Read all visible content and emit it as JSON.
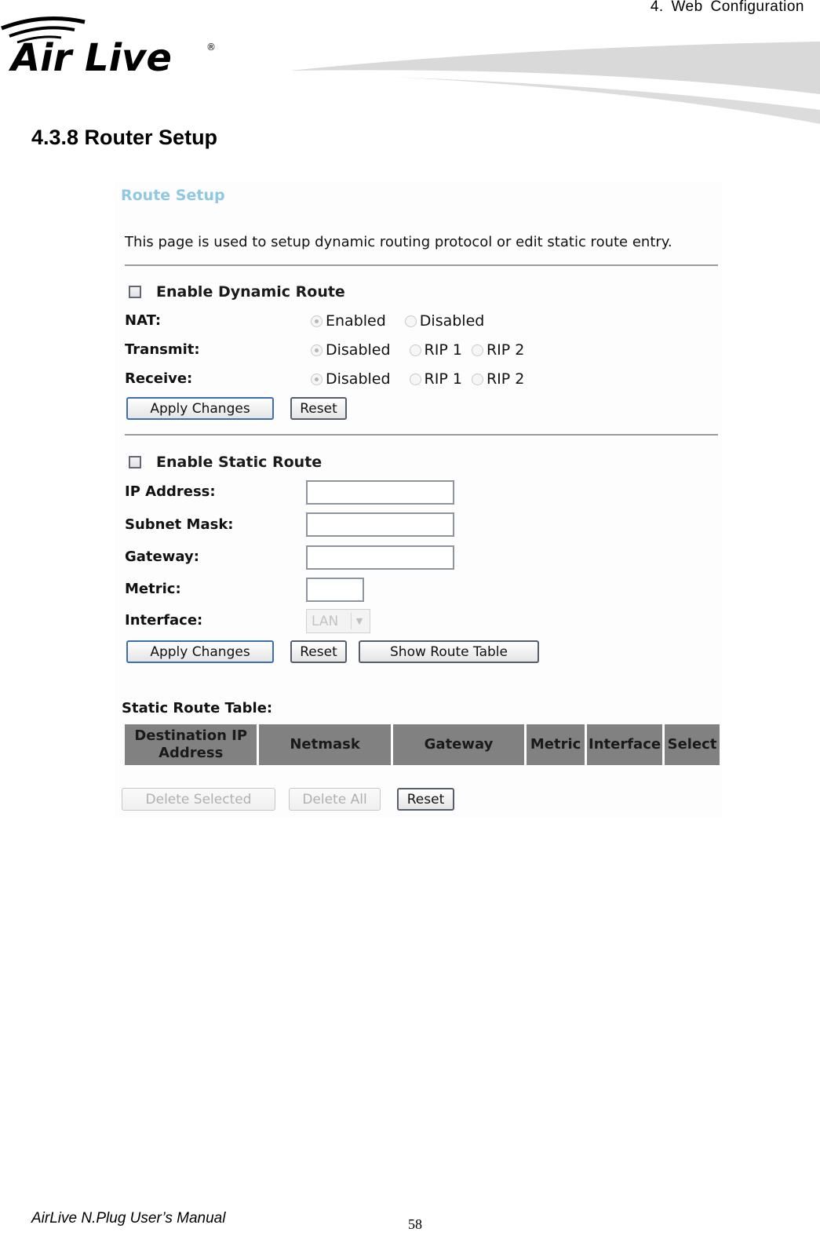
{
  "header": {
    "chapter": "4.  Web  Configuration",
    "logo": {
      "text": "Air Live",
      "registered": "®"
    }
  },
  "section": {
    "title": "4.3.8 Router Setup"
  },
  "screenshot": {
    "title": "Route Setup",
    "intro": "This page is used to setup dynamic routing protocol or edit static route entry.",
    "dynamic": {
      "checkbox_label": "Enable Dynamic Route",
      "checked": false,
      "rows": [
        {
          "label": "NAT:",
          "options": [
            "Enabled",
            "Disabled"
          ],
          "selected": "Enabled"
        },
        {
          "label": "Transmit:",
          "options": [
            "Disabled",
            "RIP 1",
            "RIP 2"
          ],
          "selected": "Disabled"
        },
        {
          "label": "Receive:",
          "options": [
            "Disabled",
            "RIP 1",
            "RIP 2"
          ],
          "selected": "Disabled"
        }
      ],
      "apply_label": "Apply Changes",
      "reset_label": "Reset"
    },
    "static": {
      "checkbox_label": "Enable Static Route",
      "checked": false,
      "fields": {
        "ip_label": "IP Address:",
        "ip_value": "",
        "mask_label": "Subnet Mask:",
        "mask_value": "",
        "gateway_label": "Gateway:",
        "gateway_value": "",
        "metric_label": "Metric:",
        "metric_value": "",
        "interface_label": "Interface:",
        "interface_value": "LAN"
      },
      "apply_label": "Apply Changes",
      "reset_label": "Reset",
      "show_table_label": "Show Route Table"
    },
    "table": {
      "label": "Static Route Table:",
      "headers": [
        "Destination IP Address",
        "Netmask",
        "Gateway",
        "Metric",
        "Interface",
        "Select"
      ],
      "rows": [],
      "delete_selected_label": "Delete Selected",
      "delete_all_label": "Delete All",
      "reset_label": "Reset"
    }
  },
  "footer": {
    "manual": "AirLive N.Plug User’s Manual",
    "page": "58"
  }
}
